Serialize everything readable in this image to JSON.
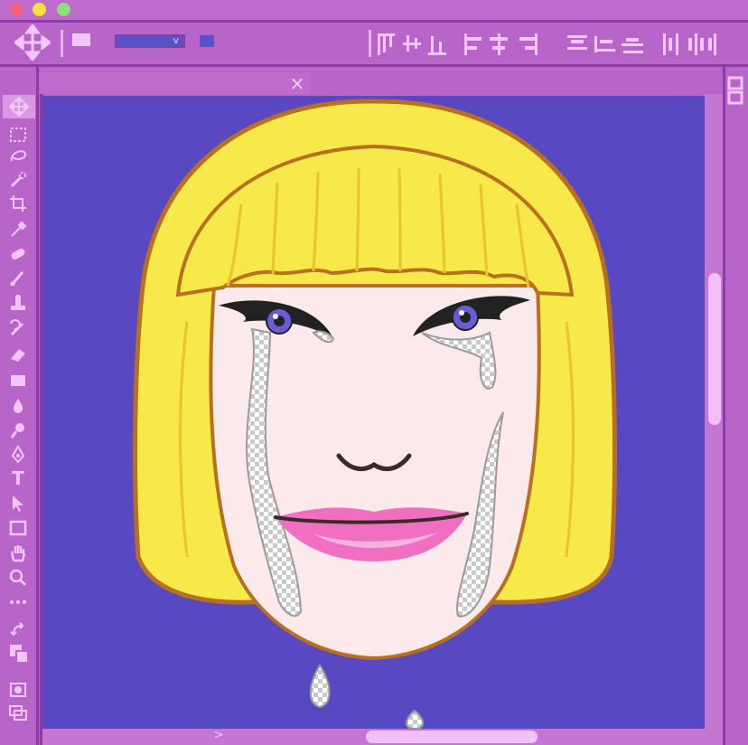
{
  "window": {
    "title": "",
    "controls": [
      "close",
      "minimize",
      "maximize"
    ]
  },
  "options_bar": {
    "tool_icon": "move-arrows-icon",
    "dropdown_value": "",
    "dropdown_caret": "v",
    "align_icons": [
      "align-top-edges-icon",
      "align-vertical-centers-icon",
      "align-bottom-edges-icon",
      "align-left-edges-icon",
      "align-horizontal-centers-icon",
      "align-right-edges-icon",
      "distribute-top-icon",
      "distribute-vertical-centers-icon",
      "distribute-bottom-icon",
      "distribute-left-icon",
      "distribute-horizontal-centers-icon",
      "distribute-right-icon"
    ]
  },
  "document": {
    "tab_title": "",
    "close_symbol": "×"
  },
  "toolbar": {
    "tools": [
      "move-tool-icon",
      "marquee-tool-icon",
      "lasso-tool-icon",
      "quick-select-tool-icon",
      "crop-tool-icon",
      "eyedropper-tool-icon",
      "healing-brush-tool-icon",
      "brush-tool-icon",
      "clone-stamp-tool-icon",
      "history-brush-tool-icon",
      "eraser-tool-icon",
      "gradient-tool-icon",
      "blur-tool-icon",
      "dodge-tool-icon",
      "pen-tool-icon",
      "type-tool-icon",
      "path-select-tool-icon",
      "rectangle-tool-icon",
      "hand-tool-icon",
      "zoom-tool-icon",
      "more-tools-icon",
      "swap-colors-icon",
      "color-swatches-icon",
      "quick-mask-icon",
      "screen-mode-icon"
    ],
    "type_tool_glyph": "T"
  },
  "scrollbars": {
    "horizontal_arrow": ">"
  },
  "colors": {
    "chrome": "#b865c9",
    "chrome_dark": "#8e3aa8",
    "canvas_bg": "#5848c2",
    "hair": "#f7e94a",
    "skin": "#fbe9ec",
    "lips": "#f06fc0"
  }
}
